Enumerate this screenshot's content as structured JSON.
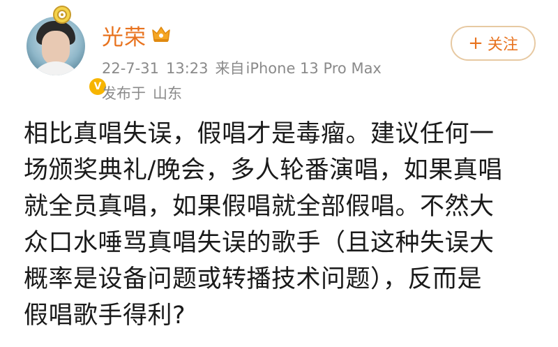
{
  "user": {
    "name": "光荣",
    "verified_badge": "V",
    "vip_icon": "crown-icon",
    "decoration_icon": "pendant-icon",
    "colors": {
      "name": "#e8731f",
      "badge": "#f7b500"
    }
  },
  "meta": {
    "date": "22-7-31",
    "time": "13:23",
    "source_prefix": "来自",
    "source": "iPhone 13 Pro Max",
    "location_label": "发布于",
    "location": "山东"
  },
  "follow_button": {
    "label": "关注",
    "icon": "+"
  },
  "post": {
    "lines": [
      "相比真唱失误，假唱才是毒瘤。建议任何一",
      "场颁奖典礼/晚会，多人轮番演唱，如果真唱",
      "就全员真唱，如果假唱就全部假唱。不然大",
      "众口水唾骂真唱失误的歌手（且这种失误大",
      "概率是设备问题或转播技术问题），反而是",
      "假唱歌手得利?"
    ]
  }
}
